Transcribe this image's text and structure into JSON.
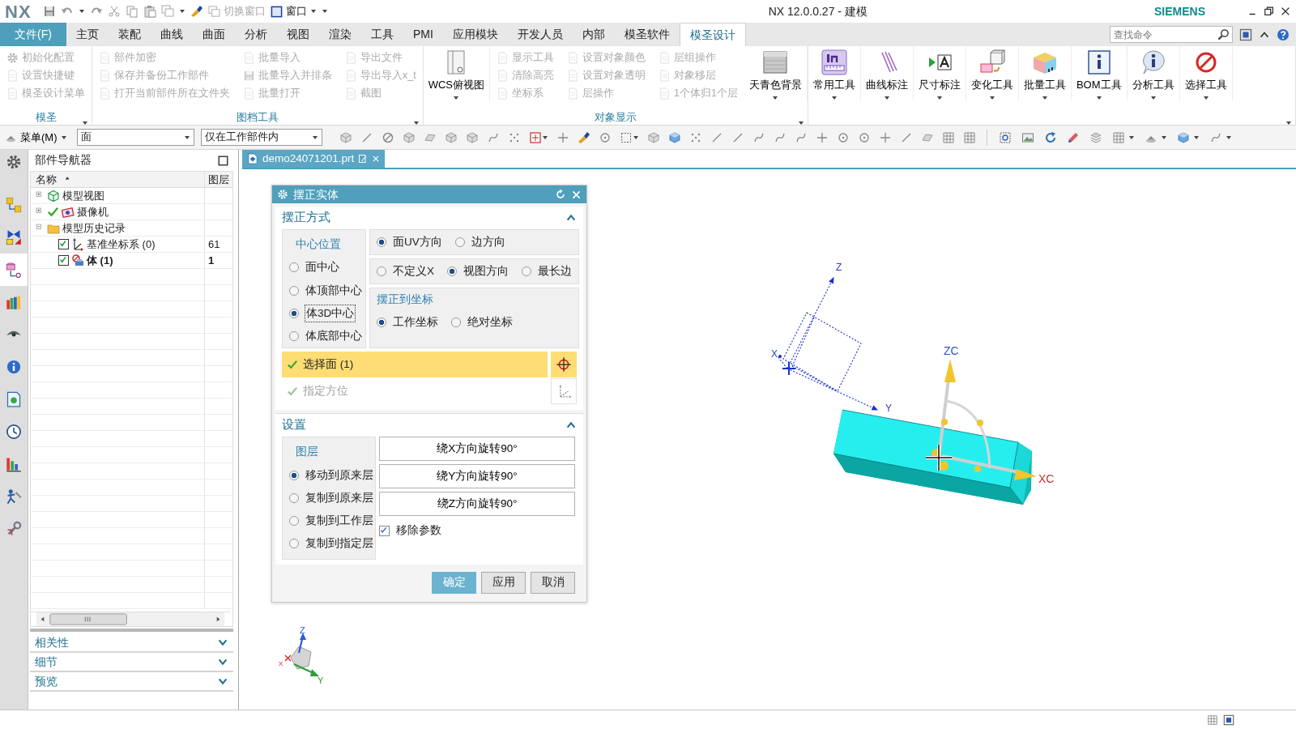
{
  "title_bar": {
    "logo": "NX",
    "quick_access": [
      {
        "label": "切换窗口",
        "disabled": true
      },
      {
        "label": "窗口",
        "disabled": false
      }
    ],
    "title": "NX 12.0.0.27 - 建模",
    "brand": "SIEMENS"
  },
  "menu_tabs": [
    {
      "label": "文件(F)",
      "kind": "file",
      "selected": false
    },
    {
      "label": "主页",
      "kind": "tab",
      "selected": false
    },
    {
      "label": "装配",
      "kind": "tab",
      "selected": false
    },
    {
      "label": "曲线",
      "kind": "tab",
      "selected": false
    },
    {
      "label": "曲面",
      "kind": "tab",
      "selected": false
    },
    {
      "label": "分析",
      "kind": "tab",
      "selected": false
    },
    {
      "label": "视图",
      "kind": "tab",
      "selected": false
    },
    {
      "label": "渲染",
      "kind": "tab",
      "selected": false
    },
    {
      "label": "工具",
      "kind": "tab",
      "selected": false
    },
    {
      "label": "PMI",
      "kind": "tab",
      "selected": false
    },
    {
      "label": "应用模块",
      "kind": "tab",
      "selected": false
    },
    {
      "label": "开发人员",
      "kind": "tab",
      "selected": false
    },
    {
      "label": "内部",
      "kind": "tab",
      "selected": false
    },
    {
      "label": "模圣软件",
      "kind": "tab",
      "selected": false
    },
    {
      "label": "模圣设计",
      "kind": "tab",
      "selected": true
    }
  ],
  "search": {
    "placeholder": "查找命令"
  },
  "ribbon": {
    "groups": [
      {
        "label": "模圣",
        "items": [
          {
            "kind": "column",
            "items": [
              {
                "label": "初始化配置",
                "disabled": true
              },
              {
                "label": "设置快捷键",
                "disabled": true
              },
              {
                "label": "模圣设计菜单",
                "disabled": true
              }
            ]
          }
        ]
      },
      {
        "label": "图档工具",
        "items": [
          {
            "kind": "column",
            "items": [
              {
                "label": "部件加密",
                "disabled": true
              },
              {
                "label": "保存并备份工作部件",
                "disabled": true
              },
              {
                "label": "打开当前部件所在文件夹",
                "disabled": true
              }
            ]
          },
          {
            "kind": "column",
            "items": [
              {
                "label": "批量导入",
                "disabled": true
              },
              {
                "label": "批量导入并排条",
                "disabled": true
              },
              {
                "label": "批量打开",
                "disabled": true
              }
            ]
          },
          {
            "kind": "column",
            "items": [
              {
                "label": "导出文件",
                "disabled": true
              },
              {
                "label": "导出导入x_t",
                "disabled": true
              },
              {
                "label": "截图",
                "disabled": true
              }
            ]
          }
        ]
      },
      {
        "label": "对象显示",
        "items": [
          {
            "kind": "large",
            "label": "WCS俯视图"
          },
          {
            "kind": "column",
            "items": [
              {
                "label": "显示工具",
                "disabled": true
              },
              {
                "label": "清除高亮",
                "disabled": true
              },
              {
                "label": "坐标系",
                "disabled": true
              }
            ]
          },
          {
            "kind": "column",
            "items": [
              {
                "label": "设置对象颜色",
                "disabled": true
              },
              {
                "label": "设置对象透明",
                "disabled": true
              },
              {
                "label": "层操作",
                "disabled": true
              }
            ]
          },
          {
            "kind": "column",
            "items": [
              {
                "label": "层组操作",
                "disabled": true
              },
              {
                "label": "对象移层",
                "disabled": true
              },
              {
                "label": "1个体归1个层",
                "disabled": true
              }
            ]
          },
          {
            "kind": "large",
            "label": "天青色背景"
          }
        ]
      },
      {
        "items": [
          {
            "kind": "large",
            "label": "常用工具"
          },
          {
            "kind": "large",
            "label": "曲线标注"
          },
          {
            "kind": "large",
            "label": "尺寸标注"
          },
          {
            "kind": "large",
            "label": "变化工具"
          },
          {
            "kind": "large",
            "label": "批量工具"
          },
          {
            "kind": "large",
            "label": "BOM工具"
          },
          {
            "kind": "large",
            "label": "分析工具"
          },
          {
            "kind": "large",
            "label": "选择工具"
          }
        ]
      }
    ]
  },
  "selection_bar": {
    "menu": "菜单(M)",
    "type_filter": "面",
    "scope_filter": "仅在工作部件内"
  },
  "resource_bar": [
    {
      "kind": "settings",
      "selected": false
    },
    {
      "kind": "assembly",
      "selected": false
    },
    {
      "kind": "constraints",
      "selected": false
    },
    {
      "kind": "part_navigator",
      "selected": true
    },
    {
      "kind": "library",
      "selected": false
    },
    {
      "kind": "visual",
      "selected": false
    },
    {
      "kind": "info",
      "selected": false
    },
    {
      "kind": "web",
      "selected": false
    },
    {
      "kind": "history",
      "selected": false
    },
    {
      "kind": "roles",
      "selected": false
    },
    {
      "kind": "scene",
      "selected": false
    },
    {
      "kind": "process",
      "selected": false
    }
  ],
  "navigator": {
    "title": "部件导航器",
    "columns": [
      "名称",
      "图层"
    ],
    "tree": [
      {
        "label": "模型视图",
        "kind": "views",
        "expanded": false
      },
      {
        "label": "摄像机",
        "kind": "cameras",
        "expanded": false
      },
      {
        "label": "模型历史记录",
        "kind": "history",
        "expanded": true,
        "children": [
          {
            "label": "基准坐标系 (0)",
            "kind": "datum",
            "layer": "61",
            "checked": true,
            "current": false
          },
          {
            "label": "体 (1)",
            "kind": "body",
            "layer": "1",
            "checked": true,
            "current": true
          }
        ]
      }
    ],
    "panels": [
      {
        "label": "相关性",
        "expanded": false
      },
      {
        "label": "细节",
        "expanded": false
      },
      {
        "label": "预览",
        "expanded": false
      }
    ]
  },
  "document_tab": {
    "label": "demo24071201.prt",
    "selected": true
  },
  "dialog": {
    "title": "摆正实体",
    "method": {
      "title": "摆正方式",
      "expanded": true,
      "center": {
        "label": "中心位置",
        "options": [
          {
            "label": "面中心",
            "selected": false
          },
          {
            "label": "体顶部中心",
            "selected": false
          },
          {
            "label": "体3D中心",
            "selected": true
          },
          {
            "label": "体底部中心",
            "selected": false
          }
        ]
      },
      "direction_rows": [
        [
          {
            "label": "面UV方向",
            "selected": true
          },
          {
            "label": "边方向",
            "selected": false
          }
        ],
        [
          {
            "label": "不定义X",
            "selected": false
          },
          {
            "label": "视图方向",
            "selected": true
          },
          {
            "label": "最长边",
            "selected": false
          }
        ]
      ],
      "align_to": {
        "label": "摆正到坐标",
        "options": [
          {
            "label": "工作坐标",
            "selected": true
          },
          {
            "label": "绝对坐标",
            "selected": false
          }
        ]
      },
      "select_face": {
        "label": "选择面 (1)",
        "active": true
      },
      "orientation": {
        "label": "指定方位",
        "disabled": true
      }
    },
    "settings": {
      "title": "设置",
      "expanded": true,
      "layer": {
        "label": "图层",
        "options": [
          {
            "label": "移动到原来层",
            "selected": true
          },
          {
            "label": "复制到原来层",
            "selected": false
          },
          {
            "label": "复制到工作层",
            "selected": false
          },
          {
            "label": "复制到指定层",
            "selected": false
          }
        ]
      },
      "rotate_buttons": [
        "绕X方向旋转90°",
        "绕Y方向旋转90°",
        "绕Z方向旋转90°"
      ],
      "remove_params": {
        "label": "移除参数",
        "checked": true
      }
    },
    "buttons": [
      {
        "label": "确定",
        "kind": "primary"
      },
      {
        "label": "应用",
        "kind": "default"
      },
      {
        "label": "取消",
        "kind": "default"
      }
    ]
  },
  "viewport": {
    "datum_labels": {
      "z": "Z",
      "x": "X",
      "y": "Y"
    },
    "manipulator_labels": {
      "z": "ZC",
      "x": "XC"
    },
    "triad_labels": {
      "z": "Z",
      "x": "X",
      "y": "Y"
    }
  }
}
